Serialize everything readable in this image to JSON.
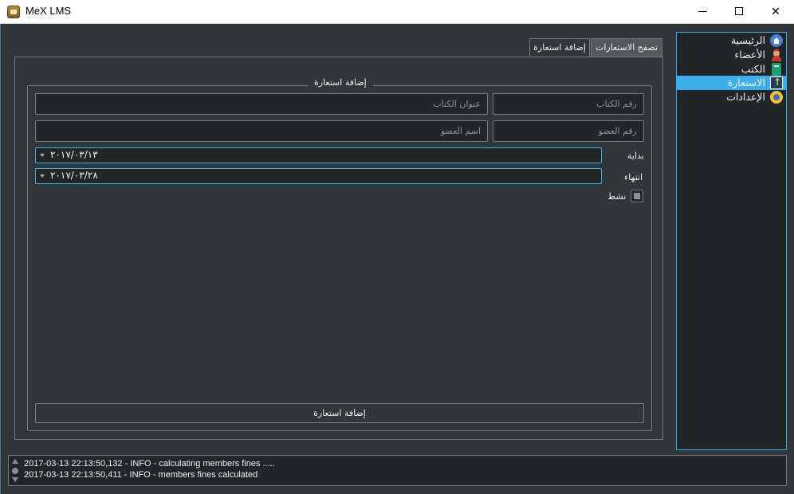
{
  "window": {
    "title": "MeX LMS",
    "minimize_icon": "minimize-icon",
    "maximize_icon": "maximize-icon",
    "close_label": "✕"
  },
  "sidebar": {
    "items": [
      {
        "label": "الرئيسية",
        "icon": "home-icon",
        "active": false
      },
      {
        "label": "الأعضاء",
        "icon": "users-icon",
        "active": false
      },
      {
        "label": "الكتب",
        "icon": "books-icon",
        "active": false
      },
      {
        "label": "الاستعارة",
        "icon": "borrow-icon",
        "active": true
      },
      {
        "label": "الإعدادات",
        "icon": "settings-icon",
        "active": false
      }
    ]
  },
  "tabs": [
    {
      "label": "تصفح الاستعارات",
      "active": true
    },
    {
      "label": "إضافة استعارة",
      "active": false
    }
  ],
  "form": {
    "group_title": "إضافة استعارة",
    "book_id_placeholder": "رقم الكتاب",
    "book_title_placeholder": "عنوان الكتاب",
    "member_id_placeholder": "رقم العضو",
    "member_name_placeholder": "اسم العضو",
    "start_label": "بداية",
    "start_value": "٢٠١٧/٠٣/١٣",
    "end_label": "انتهاء",
    "end_value": "٢٠١٧/٠٣/٢٨",
    "active_label": "نشط",
    "active_checked": false,
    "submit_label": "إضافة استعارة"
  },
  "log": {
    "lines": [
      "2017-03-13 22:13:50,132 - INFO - calculating members fines .....",
      "2017-03-13 22:13:50,411 - INFO - members fines calculated"
    ]
  },
  "colors": {
    "background": "#31363b",
    "accent": "#3daee9",
    "field": "#232629",
    "border": "#76797c"
  }
}
